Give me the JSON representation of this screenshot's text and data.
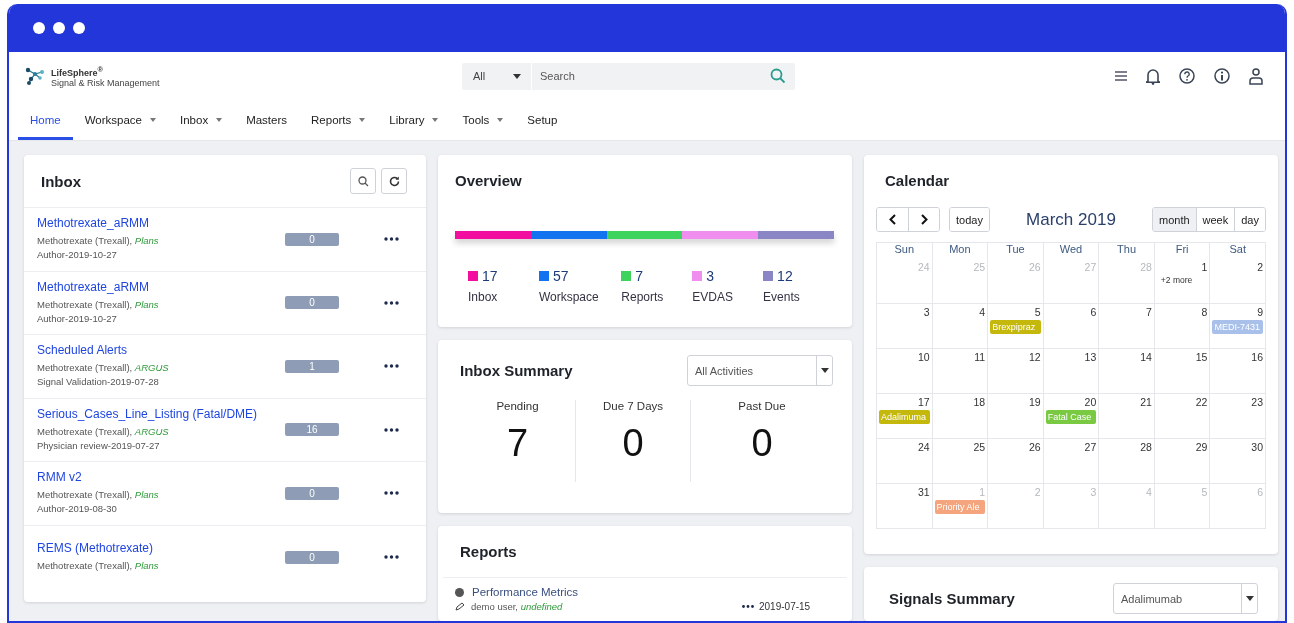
{
  "app": {
    "product": "LifeSphere$^{®}$",
    "subtitle": "Signal & Risk Management"
  },
  "search": {
    "scope": "All",
    "placeholder": "Search"
  },
  "nav": [
    {
      "label": "Home",
      "selected": true,
      "has_menu": false
    },
    {
      "label": "Workspace",
      "selected": false,
      "has_menu": true
    },
    {
      "label": "Inbox",
      "selected": false,
      "has_menu": true
    },
    {
      "label": "Masters",
      "selected": false,
      "has_menu": false
    },
    {
      "label": "Reports",
      "selected": false,
      "has_menu": true
    },
    {
      "label": "Library",
      "selected": false,
      "has_menu": true
    },
    {
      "label": "Tools",
      "selected": false,
      "has_menu": true
    },
    {
      "label": "Setup",
      "selected": false,
      "has_menu": false
    }
  ],
  "inbox": {
    "title": "Inbox",
    "items": [
      {
        "title": "Methotrexate_aRMM",
        "drug": "Methotrexate (Trexall),",
        "source": "Plans",
        "meta": "Author-2019-10-27",
        "count": "0"
      },
      {
        "title": "Methotrexate_aRMM",
        "drug": "Methotrexate (Trexall),",
        "source": "Plans",
        "meta": "Author-2019-10-27",
        "count": "0"
      },
      {
        "title": "Scheduled Alerts",
        "drug": "Methotrexate (Trexall),",
        "source": "ARGUS",
        "meta": "Signal Validation-2019-07-28",
        "count": "1"
      },
      {
        "title": "Serious_Cases_Line_Listing (Fatal/DME)",
        "drug": "Methotrexate (Trexall),",
        "source": "ARGUS",
        "meta": "Physician review-2019-07-27",
        "count": "16"
      },
      {
        "title": "RMM v2",
        "drug": "Methotrexate (Trexall),",
        "source": "Plans",
        "meta": "Author-2019-08-30",
        "count": "0"
      },
      {
        "title": "REMS (Methotrexate)",
        "drug": "Methotrexate (Trexall),",
        "source": "Plans",
        "count": "0"
      }
    ]
  },
  "overview": {
    "title": "Overview",
    "items": [
      {
        "count": "17",
        "label": "Inbox",
        "color": "#f20fa0"
      },
      {
        "count": "57",
        "label": "Workspace",
        "color": "#1273f0"
      },
      {
        "count": "7",
        "label": "Reports",
        "color": "#3ed35c"
      },
      {
        "count": "3",
        "label": "EVDAS",
        "color": "#f08ef0"
      },
      {
        "count": "12",
        "label": "Events",
        "color": "#8a86c6"
      }
    ]
  },
  "inbox_summary": {
    "title": "Inbox Summary",
    "filter": "All Activities",
    "stats": [
      {
        "label": "Pending",
        "value": "7"
      },
      {
        "label": "Due 7 Days",
        "value": "0"
      },
      {
        "label": "Past Due",
        "value": "0"
      }
    ]
  },
  "reports": {
    "title": "Reports",
    "items": [
      {
        "title": "Performance Metrics",
        "user": "demo user,",
        "source": "undefined",
        "date": "2019-07-15"
      }
    ]
  },
  "calendar": {
    "title": "Calendar",
    "month": "March 2019",
    "today": "today",
    "views": [
      {
        "label": "month",
        "selected": true
      },
      {
        "label": "week",
        "selected": false
      },
      {
        "label": "day",
        "selected": false
      }
    ],
    "weekdays": [
      "Sun",
      "Mon",
      "Tue",
      "Wed",
      "Thu",
      "Fri",
      "Sat"
    ],
    "weeks": [
      [
        {
          "day": "24",
          "other_month": true
        },
        {
          "day": "25",
          "other_month": true
        },
        {
          "day": "26",
          "other_month": true
        },
        {
          "day": "27",
          "other_month": true
        },
        {
          "day": "28",
          "other_month": true
        },
        {
          "day": "1",
          "other_month": false,
          "more": "+2 more"
        },
        {
          "day": "2",
          "other_month": false
        }
      ],
      [
        {
          "day": "3",
          "other_month": false
        },
        {
          "day": "4",
          "other_month": false
        },
        {
          "day": "5",
          "other_month": false,
          "events": [
            {
              "label": "Brexpipraz",
              "color": "#c4b80c"
            }
          ]
        },
        {
          "day": "6",
          "other_month": false
        },
        {
          "day": "7",
          "other_month": false
        },
        {
          "day": "8",
          "other_month": false
        },
        {
          "day": "9",
          "other_month": false,
          "events": [
            {
              "label": "MEDI-7431",
              "color": "#a9c1ea"
            }
          ]
        }
      ],
      [
        {
          "day": "10",
          "other_month": false
        },
        {
          "day": "11",
          "other_month": false
        },
        {
          "day": "12",
          "other_month": false
        },
        {
          "day": "13",
          "other_month": false
        },
        {
          "day": "14",
          "other_month": false
        },
        {
          "day": "15",
          "other_month": false
        },
        {
          "day": "16",
          "other_month": false
        }
      ],
      [
        {
          "day": "17",
          "other_month": false,
          "events": [
            {
              "label": "Adalimuma",
              "color": "#c4b80c"
            }
          ]
        },
        {
          "day": "18",
          "other_month": false
        },
        {
          "day": "19",
          "other_month": false
        },
        {
          "day": "20",
          "other_month": false,
          "events": [
            {
              "label": "Fatal Case",
              "color": "#7ac943"
            }
          ]
        },
        {
          "day": "21",
          "other_month": false
        },
        {
          "day": "22",
          "other_month": false
        },
        {
          "day": "23",
          "other_month": false
        }
      ],
      [
        {
          "day": "24",
          "other_month": false
        },
        {
          "day": "25",
          "other_month": false
        },
        {
          "day": "26",
          "other_month": false
        },
        {
          "day": "27",
          "other_month": false
        },
        {
          "day": "28",
          "other_month": false
        },
        {
          "day": "29",
          "other_month": false
        },
        {
          "day": "30",
          "other_month": false
        }
      ],
      [
        {
          "day": "31",
          "other_month": false
        },
        {
          "day": "1",
          "other_month": true,
          "events": [
            {
              "label": "Priority Ale",
              "color": "#f4a57e"
            }
          ]
        },
        {
          "day": "2",
          "other_month": true
        },
        {
          "day": "3",
          "other_month": true
        },
        {
          "day": "4",
          "other_month": true
        },
        {
          "day": "5",
          "other_month": true
        },
        {
          "day": "6",
          "other_month": true
        }
      ]
    ]
  },
  "signals_summary": {
    "title": "Signals Summary",
    "filter": "Adalimumab"
  }
}
